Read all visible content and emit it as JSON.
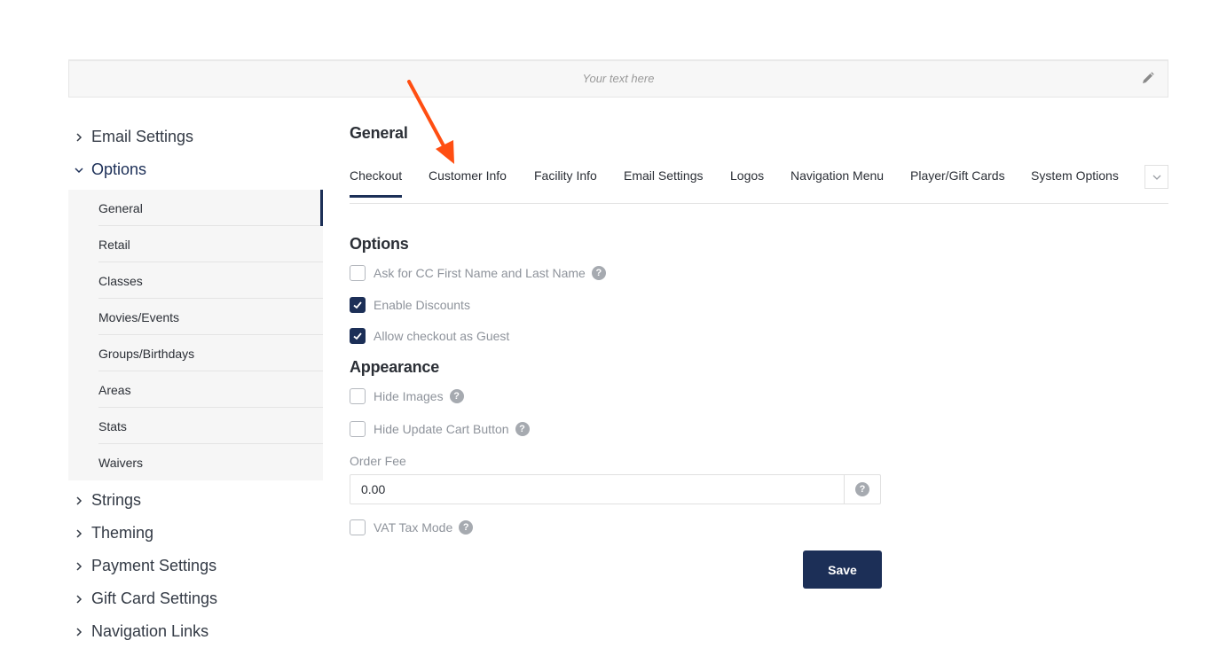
{
  "banner": {
    "placeholder": "Your text here",
    "edit_icon": "pencil-icon"
  },
  "sidebar": {
    "groups_top": [
      {
        "label": "Email Settings",
        "expanded": false
      },
      {
        "label": "Options",
        "expanded": true
      }
    ],
    "options_items": [
      "General",
      "Retail",
      "Classes",
      "Movies/Events",
      "Groups/Birthdays",
      "Areas",
      "Stats",
      "Waivers"
    ],
    "active_item": "General",
    "groups_bottom": [
      "Strings",
      "Theming",
      "Payment Settings",
      "Gift Card Settings",
      "Navigation Links"
    ]
  },
  "main": {
    "title": "General",
    "tabs": [
      "Checkout",
      "Customer Info",
      "Facility Info",
      "Email Settings",
      "Logos",
      "Navigation Menu",
      "Player/Gift Cards",
      "System Options"
    ],
    "active_tab": "Checkout",
    "more_icon": "chevron-down-icon"
  },
  "form": {
    "options_title": "Options",
    "options": [
      {
        "label": "Ask for CC First Name and Last Name",
        "checked": false,
        "help": true
      },
      {
        "label": "Enable Discounts",
        "checked": true,
        "help": false
      },
      {
        "label": "Allow checkout as Guest",
        "checked": true,
        "help": false
      }
    ],
    "appearance_title": "Appearance",
    "appearance": [
      {
        "label": "Hide Images",
        "checked": false,
        "help": true
      },
      {
        "label": "Hide Update Cart Button",
        "checked": false,
        "help": true
      }
    ],
    "order_fee_label": "Order Fee",
    "order_fee_value": "0.00",
    "vat": {
      "label": "VAT Tax Mode",
      "checked": false,
      "help": true
    },
    "help_glyph": "?",
    "save_label": "Save"
  },
  "colors": {
    "accent": "#1c2f57",
    "annotation_arrow": "#ff4e12",
    "muted_text": "#8e939b"
  }
}
